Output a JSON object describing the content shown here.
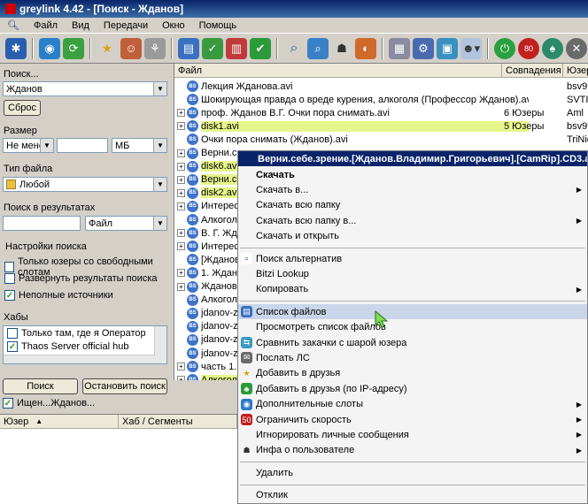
{
  "window": {
    "title": "greylink 4.42 - [Поиск - Жданов]"
  },
  "menu": [
    "Файл",
    "Вид",
    "Передачи",
    "Окно",
    "Помощь"
  ],
  "colors": {
    "highlight": "#e6f68a",
    "accent": "#0a246a",
    "selection": "#c9d6ea"
  },
  "search": {
    "label": "Поиск...",
    "query": "Жданов",
    "reset": "Сброс",
    "size_label": "Размер",
    "size_mode": "Не менее",
    "size_unit": "МБ",
    "filetype_label": "Тип файла",
    "filetype": "Любой",
    "in_results_label": "Поиск в результатах",
    "in_results_field": "Файл",
    "settings_label": "Настройки поиска",
    "options": [
      {
        "label": "Только юзеры со свободными слотам",
        "checked": false
      },
      {
        "label": "Развернуть результаты поиска",
        "checked": false
      },
      {
        "label": "Неполные источники",
        "checked": true
      }
    ],
    "hubs_label": "Хабы",
    "hubs": [
      {
        "label": "Только там, где я Оператор",
        "checked": false
      },
      {
        "label": "Thaos Server official hub",
        "checked": true
      }
    ],
    "search_button": "Поиск",
    "stop_button": "Остановить поиск"
  },
  "results": {
    "columns": [
      "Файл",
      "Совпадения",
      "Юзер"
    ],
    "rows": [
      {
        "name": "Лекция Жданова.avi",
        "matches": "",
        "user": "bsv99",
        "plus": false,
        "hl": false
      },
      {
        "name": "Шокирующая правда о вреде курения, алкоголя (Профессор Жданов).avi",
        "matches": "",
        "user": "SVTIII",
        "plus": false,
        "hl": false
      },
      {
        "name": "проф. Жданов В.Г. Очки пора снимать.avi",
        "matches": "6 Юзеры",
        "user": "Aml",
        "plus": true,
        "hl": false
      },
      {
        "name": "disk1.avi",
        "matches": "5 Юзеры",
        "user": "bsv99",
        "plus": true,
        "hl": true
      },
      {
        "name": "Очки пора снимать (Жданов).avi",
        "matches": "",
        "user": "TriNidi",
        "plus": false,
        "hl": false
      },
      {
        "name": "Верни.с",
        "matches": "",
        "user": "",
        "plus": true,
        "hl": false
      },
      {
        "name": "disk6.av",
        "matches": "",
        "user": "",
        "plus": true,
        "hl": true
      },
      {
        "name": "Верни.с",
        "matches": "",
        "user": "",
        "plus": true,
        "hl": true
      },
      {
        "name": "disk2.av",
        "matches": "",
        "user": "",
        "plus": true,
        "hl": true
      },
      {
        "name": "Интерес",
        "matches": "",
        "user": "",
        "plus": true,
        "hl": false
      },
      {
        "name": "Алкогол",
        "matches": "",
        "user": "",
        "plus": false,
        "hl": false
      },
      {
        "name": "В. Г. Жд",
        "matches": "",
        "user": "",
        "plus": true,
        "hl": false
      },
      {
        "name": "Интерес",
        "matches": "",
        "user": "",
        "plus": true,
        "hl": false
      },
      {
        "name": "[Жданов",
        "matches": "",
        "user": "",
        "plus": false,
        "hl": false
      },
      {
        "name": "1. Ждан",
        "matches": "",
        "user": "",
        "plus": true,
        "hl": false
      },
      {
        "name": "Жданов",
        "matches": "",
        "user": "",
        "plus": true,
        "hl": false
      },
      {
        "name": "Алкогол",
        "matches": "",
        "user": "",
        "plus": false,
        "hl": false
      },
      {
        "name": "jdanov-z",
        "matches": "",
        "user": "",
        "plus": false,
        "hl": false
      },
      {
        "name": "jdanov-z",
        "matches": "",
        "user": "",
        "plus": false,
        "hl": false
      },
      {
        "name": "jdanov-z",
        "matches": "",
        "user": "",
        "plus": false,
        "hl": false
      },
      {
        "name": "jdanov-z",
        "matches": "",
        "user": "",
        "plus": false,
        "hl": false
      },
      {
        "name": "часть 1.",
        "matches": "",
        "user": "",
        "plus": true,
        "hl": false
      },
      {
        "name": "Алкогол",
        "matches": "",
        "user": "",
        "plus": true,
        "hl": true
      }
    ]
  },
  "bottom": {
    "status": "Ищен...Жданов...",
    "columns": [
      "Юзер",
      "Хаб / Сегменты"
    ]
  },
  "context_menu": {
    "header": "Верни.себе.зрение.[Жданов.Владимир.Григорьевич].[CamRip].CD3.avi",
    "items": [
      {
        "label": "Скачать",
        "bold": true,
        "sub": false,
        "icon": ""
      },
      {
        "label": "Скачать в...",
        "sub": true,
        "icon": ""
      },
      {
        "label": "Скачать всю папку",
        "sub": false,
        "icon": ""
      },
      {
        "label": "Скачать всю папку в...",
        "sub": true,
        "icon": ""
      },
      {
        "label": "Скачать и открыть",
        "sub": false,
        "icon": ""
      },
      {
        "sep": true
      },
      {
        "label": "Поиск альтернатив",
        "sub": false,
        "icon": "search-icon"
      },
      {
        "label": "Bitzi Lookup",
        "sub": false,
        "icon": ""
      },
      {
        "label": "Копировать",
        "sub": true,
        "icon": ""
      },
      {
        "sep": true
      },
      {
        "label": "Список файлов",
        "sub": false,
        "icon": "file-list-icon",
        "selected": true
      },
      {
        "label": "Просмотреть список файлов",
        "sub": false,
        "icon": ""
      },
      {
        "label": "Сравнить закачки с шарой юзера",
        "sub": false,
        "icon": "compare-icon"
      },
      {
        "label": "Послать ЛС",
        "sub": false,
        "icon": "message-icon"
      },
      {
        "label": "Добавить в друзья",
        "sub": false,
        "icon": "star-icon"
      },
      {
        "label": "Добавить в друзья (по IP-адресу)",
        "sub": false,
        "icon": "clover-icon"
      },
      {
        "label": "Дополнительные слоты",
        "sub": true,
        "icon": "globe-icon"
      },
      {
        "label": "Ограничить скорость",
        "sub": true,
        "icon": "speed-icon"
      },
      {
        "label": "Игнорировать личные сообщения",
        "sub": true,
        "icon": ""
      },
      {
        "label": "Инфа о пользователе",
        "sub": true,
        "icon": "hat-icon"
      },
      {
        "sep": true
      },
      {
        "label": "Удалить",
        "sub": false,
        "icon": ""
      },
      {
        "sep": true
      },
      {
        "label": "Отклик",
        "sub": false,
        "icon": ""
      }
    ]
  }
}
